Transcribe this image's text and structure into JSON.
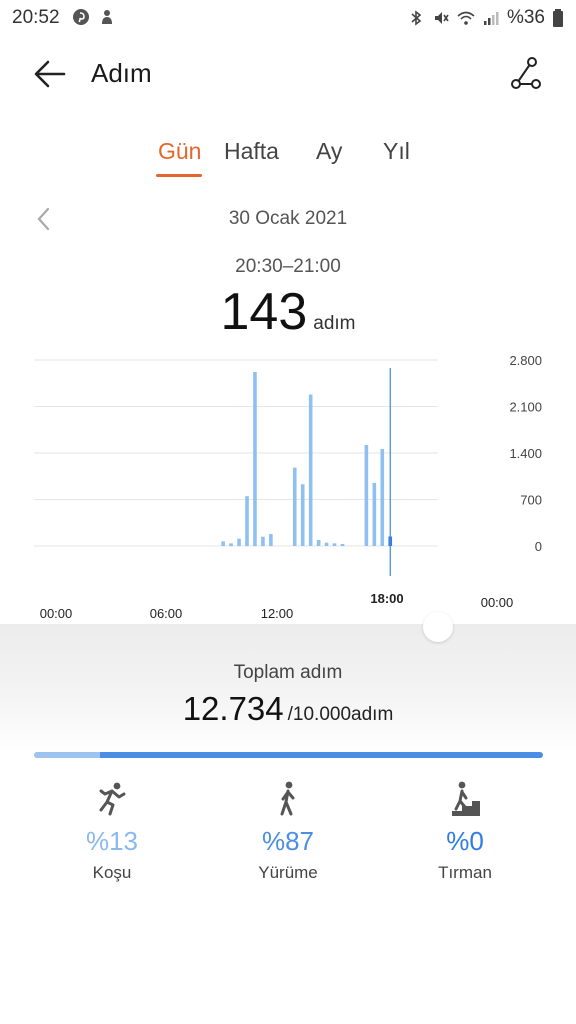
{
  "status_bar": {
    "time": "20:52",
    "battery": "%36",
    "icons": [
      "pinterest-icon",
      "notification-icon",
      "bluetooth-icon",
      "mute-icon",
      "wifi-icon",
      "signal-icon",
      "battery-icon"
    ]
  },
  "header": {
    "title": "Adım",
    "back_icon": "arrow-left-icon",
    "share_icon": "share-route-icon"
  },
  "tabs": [
    {
      "label": "Gün",
      "active": true
    },
    {
      "label": "Hafta",
      "active": false
    },
    {
      "label": "Ay",
      "active": false
    },
    {
      "label": "Yıl",
      "active": false
    }
  ],
  "date_nav": {
    "date": "30 Ocak 2021"
  },
  "selection": {
    "time_range": "20:30–21:00",
    "value": "143",
    "unit": "adım"
  },
  "chart_data": {
    "type": "bar",
    "x_ticks": [
      "00:00",
      "06:00",
      "12:00",
      "18:00",
      "00:00"
    ],
    "y_ticks": [
      "2.800",
      "2.100",
      "1.400",
      "700",
      "0"
    ],
    "ylim": [
      0,
      2800
    ],
    "grid": true,
    "bars": [
      {
        "time": "10:30",
        "value": 70
      },
      {
        "time": "11:00",
        "value": 40
      },
      {
        "time": "11:30",
        "value": 110
      },
      {
        "time": "12:00",
        "value": 750
      },
      {
        "time": "12:30",
        "value": 2620
      },
      {
        "time": "13:00",
        "value": 140
      },
      {
        "time": "13:30",
        "value": 180
      },
      {
        "time": "15:00",
        "value": 1180
      },
      {
        "time": "15:30",
        "value": 930
      },
      {
        "time": "16:00",
        "value": 2280
      },
      {
        "time": "16:30",
        "value": 90
      },
      {
        "time": "17:00",
        "value": 50
      },
      {
        "time": "17:30",
        "value": 40
      },
      {
        "time": "18:00",
        "value": 30
      },
      {
        "time": "19:30",
        "value": 1520
      },
      {
        "time": "20:00",
        "value": 950
      },
      {
        "time": "20:30",
        "value": 1460
      },
      {
        "time": "21:00",
        "value": 143,
        "selected": true
      }
    ],
    "colors": {
      "bar": "#8ec0f2",
      "selected": "#2f7de1",
      "grid": "#e6e6e6"
    }
  },
  "summary": {
    "label": "Toplam adım",
    "total": "12.734",
    "goal": "/10.000adım",
    "run_fraction": 0.13,
    "walk_fraction": 0.87
  },
  "activities": [
    {
      "icon": "running-icon",
      "percent": "%13",
      "label": "Koşu",
      "color": "#8ab8ef"
    },
    {
      "icon": "walking-icon",
      "percent": "%87",
      "label": "Yürüme",
      "color": "#4a8fe3"
    },
    {
      "icon": "climbing-icon",
      "percent": "%0",
      "label": "Tırman",
      "color": "#2f7de1"
    }
  ]
}
